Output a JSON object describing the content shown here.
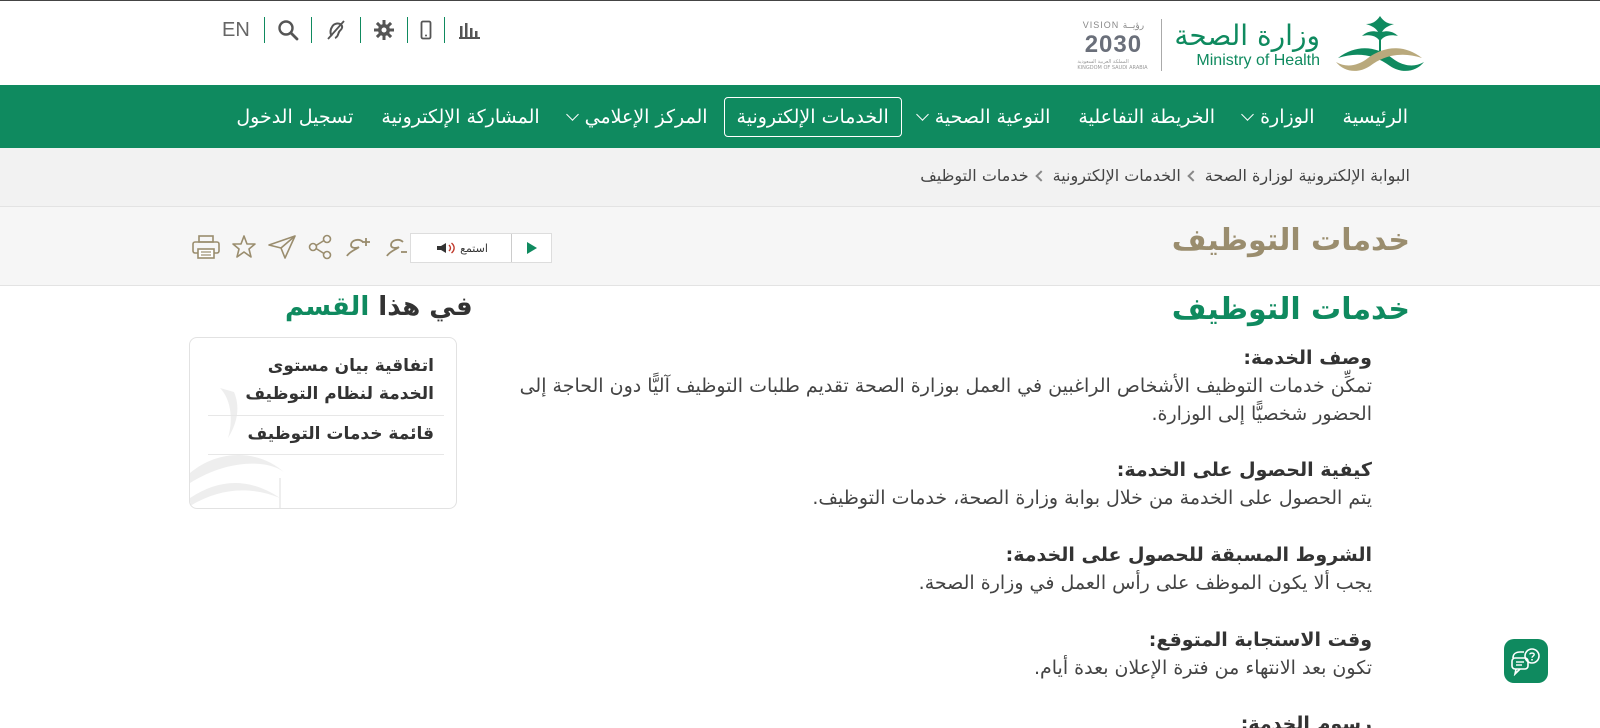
{
  "header": {
    "logo_ar": "وزارة الصحة",
    "logo_en": "Ministry of Health",
    "vision_top": "VISION رؤيــة",
    "vision_year": "2030",
    "vision_sub": "المملكة العربية السعودية KINGDOM OF SAUDI ARABIA",
    "lang_label": "EN",
    "tools": [
      "search-icon",
      "accessibility-ear-icon",
      "gear-icon",
      "mobile-icon",
      "stats-chart-icon"
    ]
  },
  "nav": {
    "items": [
      {
        "label": "الرئيسية",
        "has_dropdown": false
      },
      {
        "label": "الوزارة",
        "has_dropdown": true
      },
      {
        "label": "الخريطة التفاعلية",
        "has_dropdown": false
      },
      {
        "label": "التوعية الصحية",
        "has_dropdown": true
      },
      {
        "label": "الخدمات الإلكترونية",
        "has_dropdown": false,
        "active": true
      },
      {
        "label": "المركز الإعلامي",
        "has_dropdown": true
      },
      {
        "label": "المشاركة الإلكترونية",
        "has_dropdown": false
      },
      {
        "label": "تسجيل الدخول",
        "has_dropdown": false
      }
    ]
  },
  "breadcrumb": [
    "البوابة الإلكترونية لوزارة الصحة",
    "الخدمات الإلكترونية",
    "خدمات التوظيف"
  ],
  "page": {
    "title": "خدمات التوظيف",
    "listen_label": "استمع",
    "actions": [
      "font-decrease-icon",
      "font-increase-icon",
      "share-icon",
      "send-icon",
      "star-icon",
      "print-icon"
    ]
  },
  "main": {
    "title": "خدمات التوظيف",
    "sections": [
      {
        "heading": "وصف الخدمة:",
        "text": "تمكِّن خدمات التوظيف الأشخاص الراغبين في العمل بوزارة الصحة تقديم طلبات التوظيف آليًّا دون الحاجة إلى الحضور شخصيًّا إلى الوزارة."
      },
      {
        "heading": "كيفية الحصول على الخدمة:",
        "text": "يتم الحصول على الخدمة من خلال بوابة وزارة الصحة، خدمات التوظيف."
      },
      {
        "heading": "الشروط المسبقة للحصول على الخدمة:",
        "text": "يجب ألا يكون الموظف على رأس العمل في وزارة الصحة."
      },
      {
        "heading": "وقت الاستجابة المتوقع:",
        "text": "تكون بعد الانتهاء من فترة الإعلان بعدة أيام."
      },
      {
        "heading": "رسوم الخدمة:",
        "text": ""
      }
    ]
  },
  "sidebar": {
    "title_dark": "في هذا",
    "title_green": "القسم",
    "items": [
      "اتفاقية بيان مستوى الخدمة لنظام التوظيف",
      "قائمة خدمات التوظيف"
    ]
  },
  "colors": {
    "brand_green": "#0f8a5f",
    "title_gold": "#9a8d6e"
  }
}
